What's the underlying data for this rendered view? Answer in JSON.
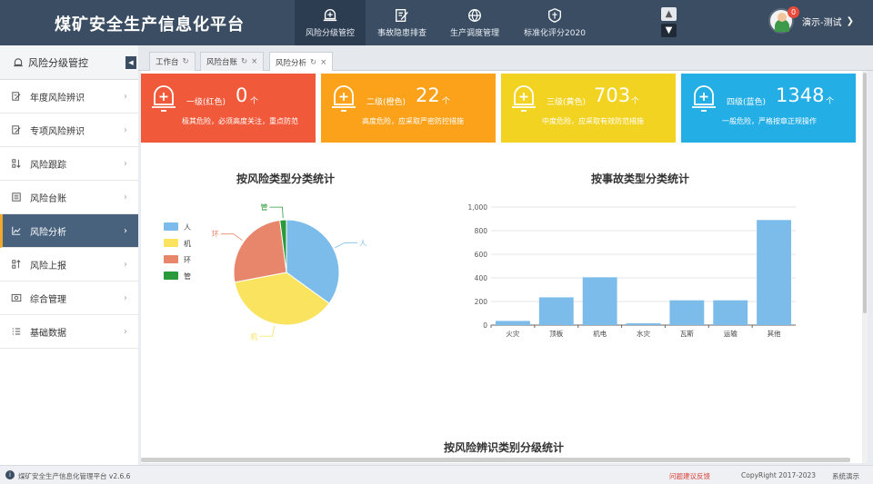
{
  "header": {
    "title": "煤矿安全生产信息化平台",
    "nav": [
      {
        "label": "风险分级管控",
        "icon": "alarm-bell-icon"
      },
      {
        "label": "事故隐患排查",
        "icon": "edit-document-icon"
      },
      {
        "label": "生产调度管理",
        "icon": "dispatch-globe-icon"
      },
      {
        "label": "标准化评分2020",
        "icon": "quality-badge-icon"
      }
    ],
    "user": {
      "name": "演示-测试",
      "notifications": "0"
    }
  },
  "sidebar": {
    "title": "风险分级管控",
    "items": [
      {
        "label": "年度风险辨识"
      },
      {
        "label": "专项风险辨识"
      },
      {
        "label": "风险跟踪"
      },
      {
        "label": "风险台账"
      },
      {
        "label": "风险分析"
      },
      {
        "label": "风险上报"
      },
      {
        "label": "综合管理"
      },
      {
        "label": "基础数据"
      }
    ]
  },
  "tabs": [
    {
      "label": "工作台"
    },
    {
      "label": "风险台账"
    },
    {
      "label": "风险分析"
    }
  ],
  "cards": [
    {
      "title": "一级(红色)",
      "value": "0",
      "unit": "个",
      "desc": "极其危险，必须高度关注，重点防范",
      "color": "#f05a3a"
    },
    {
      "title": "二级(橙色)",
      "value": "22",
      "unit": "个",
      "desc": "高度危险，应采取严密防控措施",
      "color": "#fba21a"
    },
    {
      "title": "三级(黄色)",
      "value": "703",
      "unit": "个",
      "desc": "中度危险，应采取有效防范措施",
      "color": "#f3d321"
    },
    {
      "title": "四级(蓝色)",
      "value": "1348",
      "unit": "个",
      "desc": "一般危险，严格按章正规操作",
      "color": "#24aee6"
    }
  ],
  "chart_data": [
    {
      "type": "pie",
      "title": "按风险类型分类统计",
      "legend": [
        "人",
        "机",
        "环",
        "管"
      ],
      "legend_position": "left",
      "values": [
        35,
        37,
        26,
        2
      ],
      "colors": [
        "#7cbcea",
        "#fae35f",
        "#e8866c",
        "#2a9a3a"
      ]
    },
    {
      "type": "bar",
      "title": "按事故类型分类统计",
      "categories": [
        "火灾",
        "顶板",
        "机电",
        "水灾",
        "瓦斯",
        "运输",
        "其他"
      ],
      "values": [
        35,
        235,
        405,
        15,
        210,
        210,
        890
      ],
      "ylim": [
        0,
        1000
      ],
      "yticks": [
        "0",
        "200",
        "400",
        "600",
        "800",
        "1,000"
      ],
      "color": "#7cbcea",
      "grid": true
    }
  ],
  "section3_title": "按风险辨识类别分级统计",
  "footer": {
    "version": "煤矿安全生产信息化管理平台 v2.6.6",
    "feedback": "问题建议反馈",
    "copyright": "CopyRight 2017-2023",
    "mode": "系统演示"
  }
}
